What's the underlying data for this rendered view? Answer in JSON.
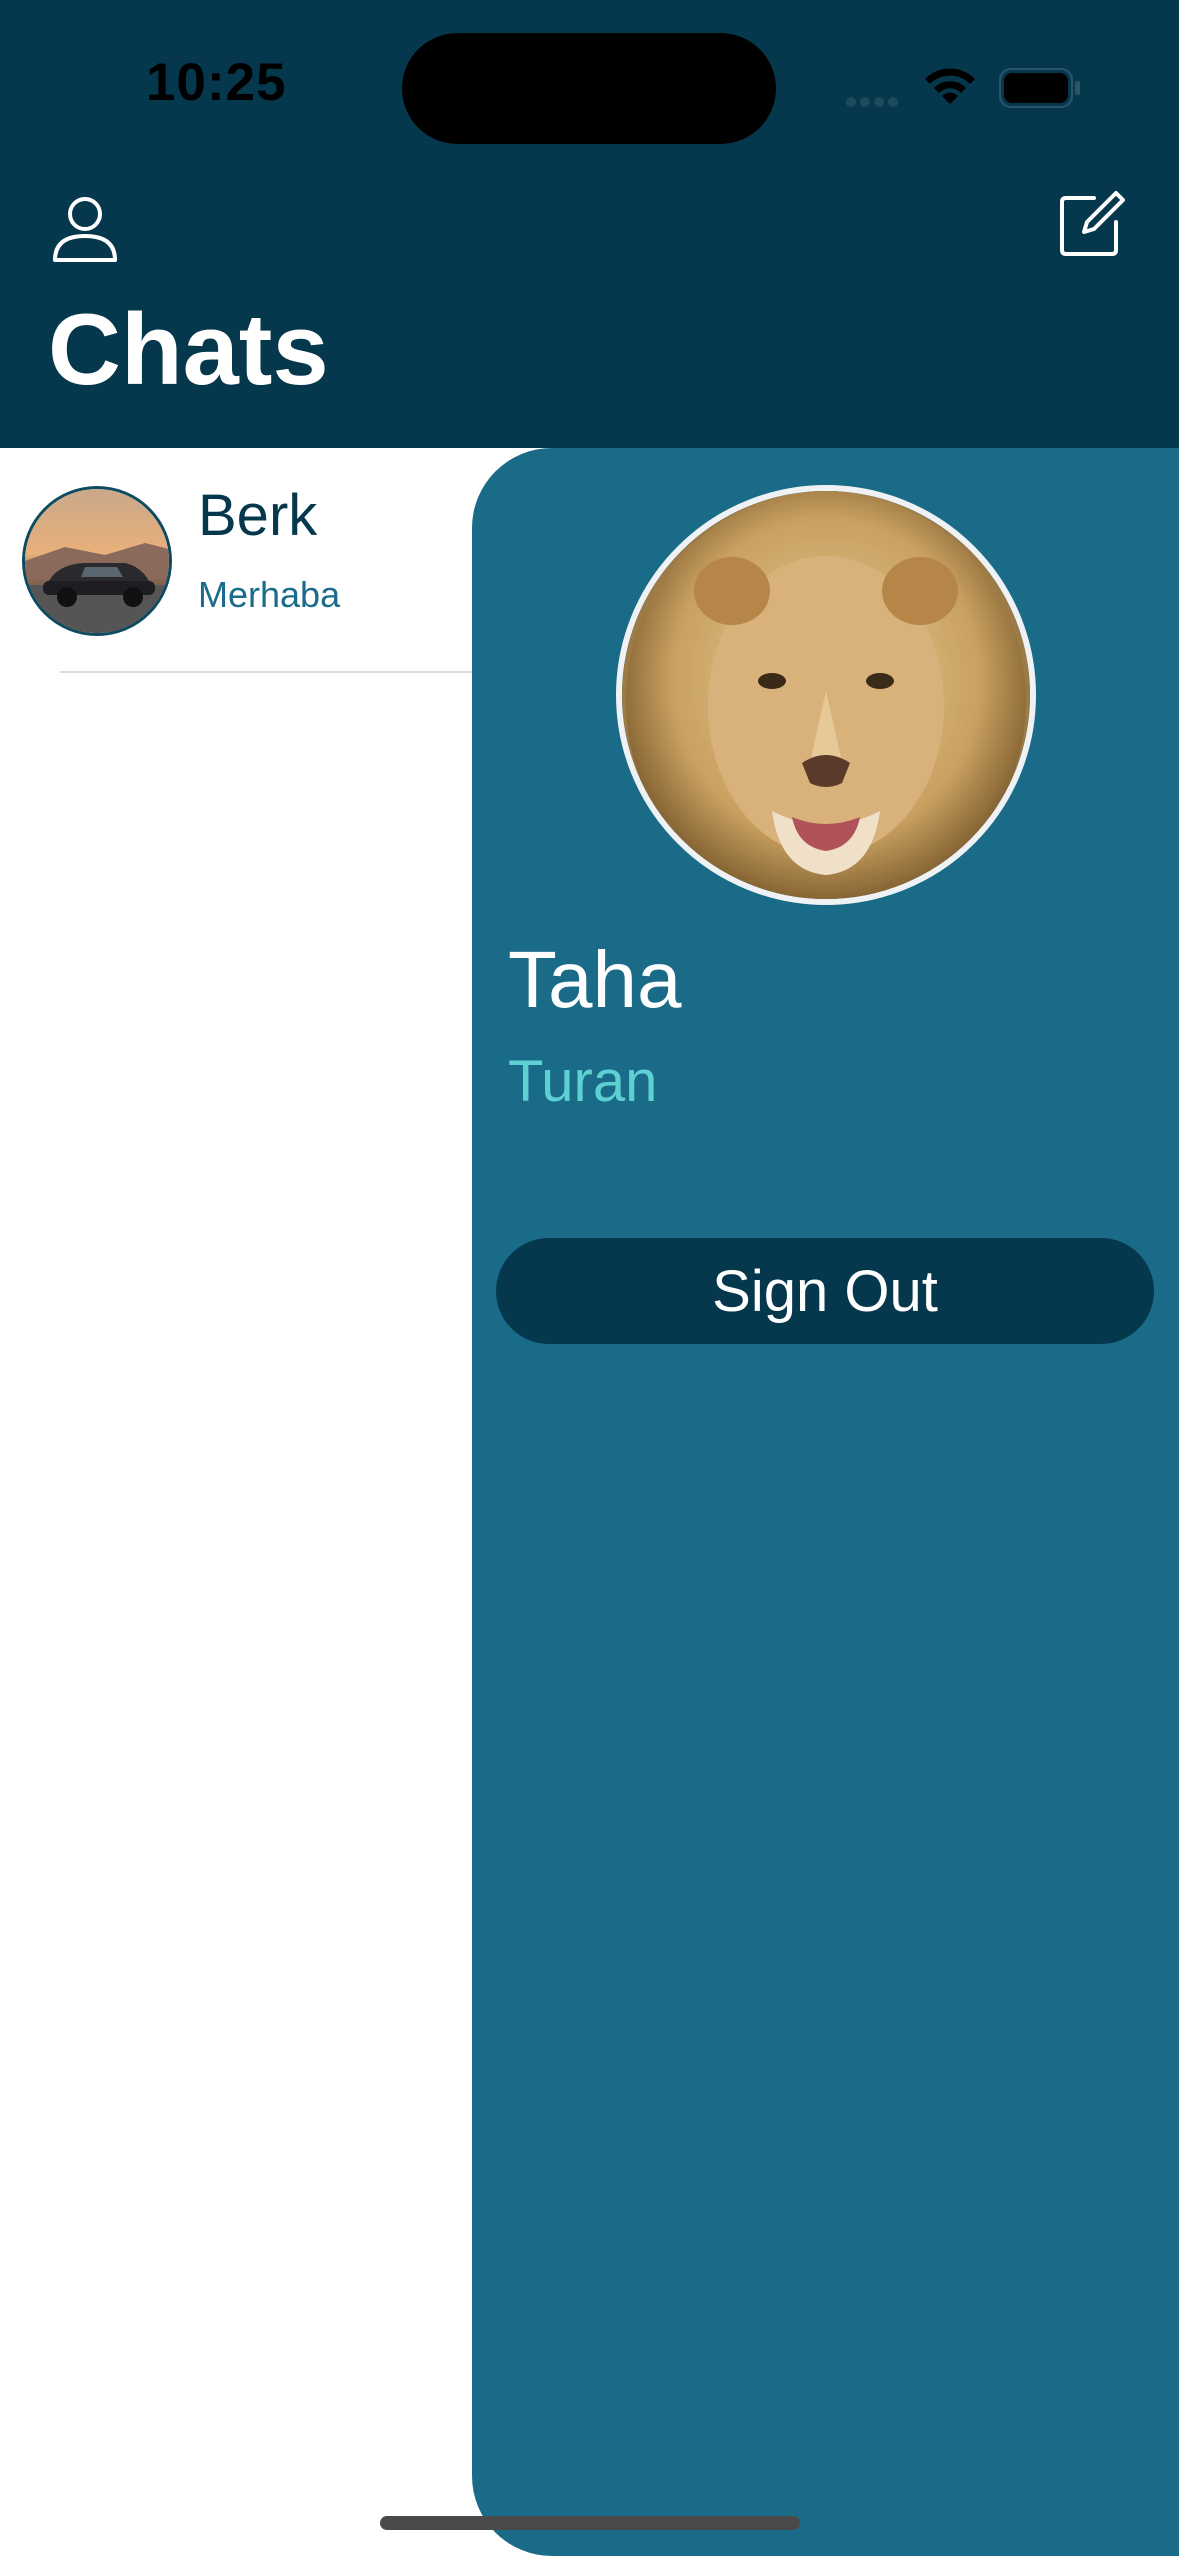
{
  "status_bar": {
    "time": "10:25",
    "icons": [
      "signal-icon",
      "wifi-icon",
      "battery-icon"
    ]
  },
  "header": {
    "title": "Chats",
    "left_icon": "person-icon",
    "right_icon": "compose-icon",
    "background": "#06384d"
  },
  "chats": [
    {
      "name": "Berk",
      "last_message": "Merhaba",
      "avatar": "car-photo"
    }
  ],
  "drawer": {
    "avatar": "lion-photo",
    "first_name": "Taha",
    "last_name": "Turan",
    "sign_out_label": "Sign Out",
    "background": "#1a6b88"
  },
  "colors": {
    "accent": "#5fd0d2",
    "primary_dark": "#06384d",
    "drawer_bg": "#1a6b88"
  }
}
